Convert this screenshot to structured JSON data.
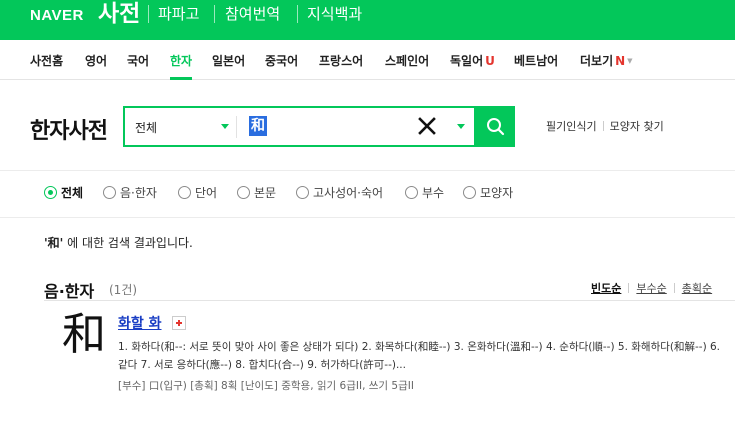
{
  "header": {
    "brand": "NAVER",
    "title": "사전",
    "links": [
      "파파고",
      "참여번역",
      "지식백과"
    ]
  },
  "nav": {
    "items": [
      "사전홈",
      "영어",
      "국어",
      "한자",
      "일본어",
      "중국어",
      "프랑스어",
      "스페인어",
      "독일어",
      "베트남어",
      "더보기"
    ],
    "active_index": 3,
    "german_badge": "U",
    "more_badge": "N"
  },
  "search": {
    "dict_title": "한자사전",
    "scope": "전체",
    "query": "和",
    "side_links": [
      "필기인식기",
      "모양자 찾기"
    ]
  },
  "filters": {
    "items": [
      "전체",
      "음·한자",
      "단어",
      "본문",
      "고사성어·숙어",
      "부수",
      "모양자"
    ],
    "selected_index": 0
  },
  "result_notice": {
    "term": "'和'",
    "suffix": " 에 대한 검색 결과입니다."
  },
  "section": {
    "title": "음·한자",
    "count": "(1건)",
    "sorts": [
      "빈도순",
      "부수순",
      "총획순"
    ],
    "sort_selected": 0
  },
  "entry": {
    "char": "和",
    "title": "화할 화",
    "definition": "1. 화하다(和--: 서로 뜻이 맞아 사이 좋은 상태가 되다) 2. 화목하다(和睦--) 3. 온화하다(溫和--) 4. 순하다(順--) 5. 화해하다(和解--) 6. 같다 7. 서로 응하다(應--) 8. 합치다(合--) 9. 허가하다(許可--)...",
    "meta": "[부수] 口(입구)  [총획] 8획  [난이도] 중학용, 읽기 6급II, 쓰기 5급II"
  },
  "colors": {
    "naver_green": "#03c75a",
    "link_blue": "#1a3ec4",
    "badge_red": "#e4352e",
    "selection_blue": "#2a6ddf"
  },
  "icons": [
    "clear-icon",
    "search-icon",
    "plus-icon",
    "caret-down-icon"
  ]
}
